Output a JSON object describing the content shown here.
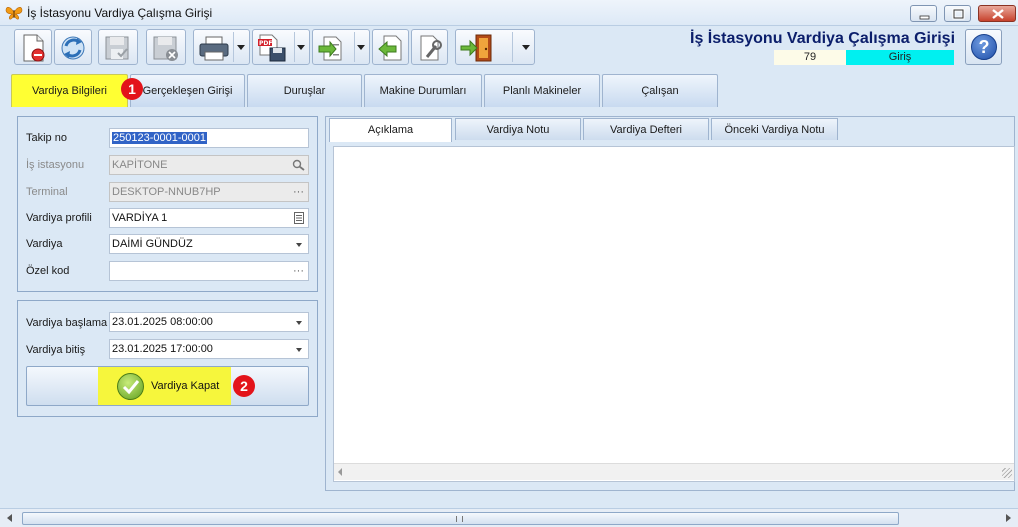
{
  "window": {
    "title": "İş İstasyonu Vardiya Çalışma Girişi"
  },
  "toolbar": {
    "buttons": [
      {
        "icon": "new-document-icon"
      },
      {
        "icon": "refresh-icon"
      },
      {
        "icon": "save-disabled-icon"
      },
      {
        "icon": "delete-disabled-icon"
      },
      {
        "icon": "print-icon"
      },
      {
        "icon": "export-pdf-icon"
      },
      {
        "icon": "import-export-icon"
      },
      {
        "icon": "back-icon"
      },
      {
        "icon": "settings-icon"
      },
      {
        "icon": "exit-door-icon"
      }
    ]
  },
  "header": {
    "title": "İş İstasyonu Vardiya Çalışma Girişi",
    "record_number": "79",
    "mode": "Giriş",
    "mode_color": "#00f0f0"
  },
  "tabs": [
    {
      "label": "Vardiya Bilgileri",
      "active": true
    },
    {
      "label": "Gerçekleşen Girişi"
    },
    {
      "label": "Duruşlar"
    },
    {
      "label": "Makine Durumları"
    },
    {
      "label": "Planlı Makineler"
    },
    {
      "label": "Çalışan"
    }
  ],
  "annotations": {
    "badge1": "1",
    "badge2": "2",
    "highlight_color": "#ffff33",
    "badge_color": "#e3131a"
  },
  "form": {
    "takip_no": {
      "label": "Takip no",
      "value": "250123-0001-0001"
    },
    "is_istasyonu": {
      "label": "İş istasyonu",
      "value": "KAPİTONE"
    },
    "terminal": {
      "label": "Terminal",
      "value": "DESKTOP-NNUB7HP"
    },
    "vardiya_profili": {
      "label": "Vardiya profili",
      "value": "VARDİYA 1"
    },
    "vardiya": {
      "label": "Vardiya",
      "value": "DAİMİ GÜNDÜZ"
    },
    "ozel_kod": {
      "label": "Özel kod",
      "value": ""
    },
    "vardiya_baslama": {
      "label": "Vardiya başlama",
      "value": "23.01.2025 08:00:00"
    },
    "vardiya_bitis": {
      "label": "Vardiya bitiş",
      "value": "23.01.2025 17:00:00"
    },
    "close_button": "Vardiya Kapat"
  },
  "sub_tabs": [
    {
      "label": "Açıklama",
      "active": true
    },
    {
      "label": "Vardiya Notu"
    },
    {
      "label": "Vardiya Defteri"
    },
    {
      "label": "Önceki Vardiya Notu"
    }
  ]
}
